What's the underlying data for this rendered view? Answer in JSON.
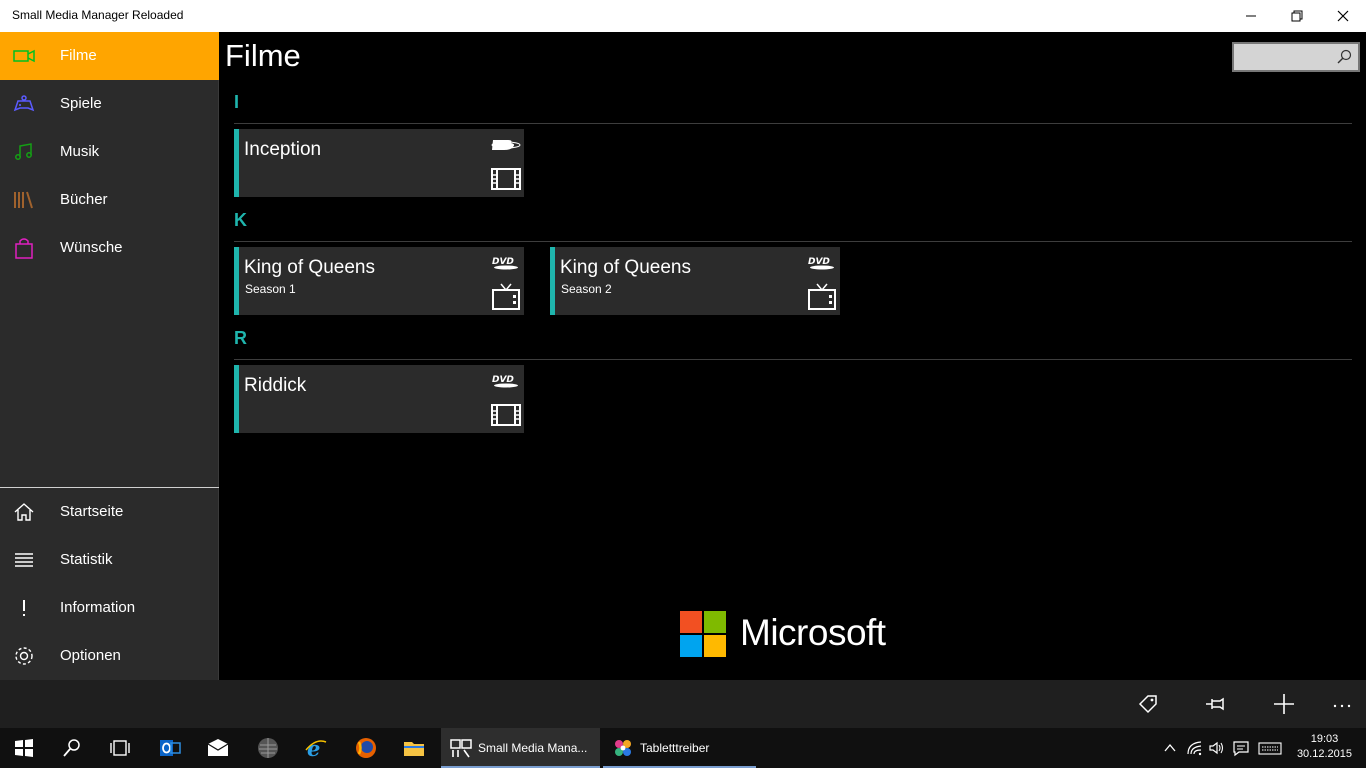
{
  "window": {
    "title": "Small Media Manager Reloaded"
  },
  "sidebar": {
    "items": [
      {
        "label": "Filme",
        "icon": "video-camera-icon",
        "color": "#00c020",
        "active": true
      },
      {
        "label": "Spiele",
        "icon": "gamepad-icon",
        "color": "#5b5bff"
      },
      {
        "label": "Musik",
        "icon": "music-note-icon",
        "color": "#14a014"
      },
      {
        "label": "Bücher",
        "icon": "books-icon",
        "color": "#a0622d"
      },
      {
        "label": "Wünsche",
        "icon": "shopping-bag-icon",
        "color": "#e020c0"
      }
    ],
    "bottom_items": [
      {
        "label": "Startseite",
        "icon": "home-icon"
      },
      {
        "label": "Statistik",
        "icon": "list-icon"
      },
      {
        "label": "Information",
        "icon": "exclamation-icon"
      },
      {
        "label": "Optionen",
        "icon": "gear-icon"
      }
    ],
    "active_color": "#ffa500"
  },
  "main": {
    "page_title": "Filme",
    "search": {
      "placeholder": "",
      "icon": "search-icon"
    },
    "groups": [
      {
        "letter": "I",
        "items": [
          {
            "title": "Inception",
            "subtitle": "",
            "format": "bluray-icon",
            "kind": "film-strip-icon"
          }
        ]
      },
      {
        "letter": "K",
        "items": [
          {
            "title": "King of Queens",
            "subtitle": "Season 1",
            "format": "dvd-icon",
            "kind": "tv-icon"
          },
          {
            "title": "King of Queens",
            "subtitle": "Season 2",
            "format": "dvd-icon",
            "kind": "tv-icon"
          }
        ]
      },
      {
        "letter": "R",
        "items": [
          {
            "title": "Riddick",
            "subtitle": "",
            "format": "dvd-icon",
            "kind": "film-strip-icon"
          }
        ]
      }
    ],
    "accent": "#1fb5ad",
    "ad": {
      "text": "Microsoft"
    }
  },
  "appbar": {
    "buttons": [
      "tag-icon",
      "pin-icon",
      "plus-icon",
      "more-icon"
    ]
  },
  "taskbar": {
    "tasks": [
      {
        "label": "Small Media Mana...",
        "active": true
      },
      {
        "label": "Tabletttreiber",
        "active": false
      }
    ],
    "clock": {
      "time": "19:03",
      "date": "30.12.2015"
    }
  }
}
